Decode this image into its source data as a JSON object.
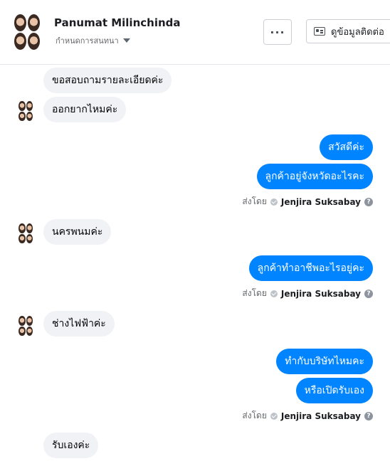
{
  "header": {
    "contact_name": "Panumat Milinchinda",
    "assign_label": "กำหนดการสนทนา",
    "more_label": "···",
    "info_button_label": "ดูข้อมูลติดต่อ"
  },
  "sent_by": {
    "prefix": "ส่งโดย",
    "agent": "Jenjira Suksabay",
    "help": "?"
  },
  "messages": [
    {
      "direction": "incoming",
      "text": "ขอสอบถามรายละเอียดค่ะ"
    },
    {
      "direction": "incoming",
      "text": "ออกยากไหมค่ะ"
    },
    {
      "direction": "outgoing",
      "text": "สวัสดีค่ะ"
    },
    {
      "direction": "outgoing",
      "text": "ลูกค้าอยู่จังหวัดอะไรคะ"
    },
    {
      "direction": "incoming",
      "text": "นครพนมค่ะ"
    },
    {
      "direction": "outgoing",
      "text": "ลูกค้าทำอาชีพอะไรอยู่คะ"
    },
    {
      "direction": "incoming",
      "text": "ช่างไฟฟ้าค่ะ"
    },
    {
      "direction": "outgoing",
      "text": "ทำกับบริษัทไหมคะ"
    },
    {
      "direction": "outgoing",
      "text": "หรือเปิดรับเอง"
    },
    {
      "direction": "incoming",
      "text": "รับเองค่ะ"
    }
  ],
  "colors": {
    "outgoing_bubble": "#0084ff",
    "incoming_bubble": "#f0f2f5"
  }
}
